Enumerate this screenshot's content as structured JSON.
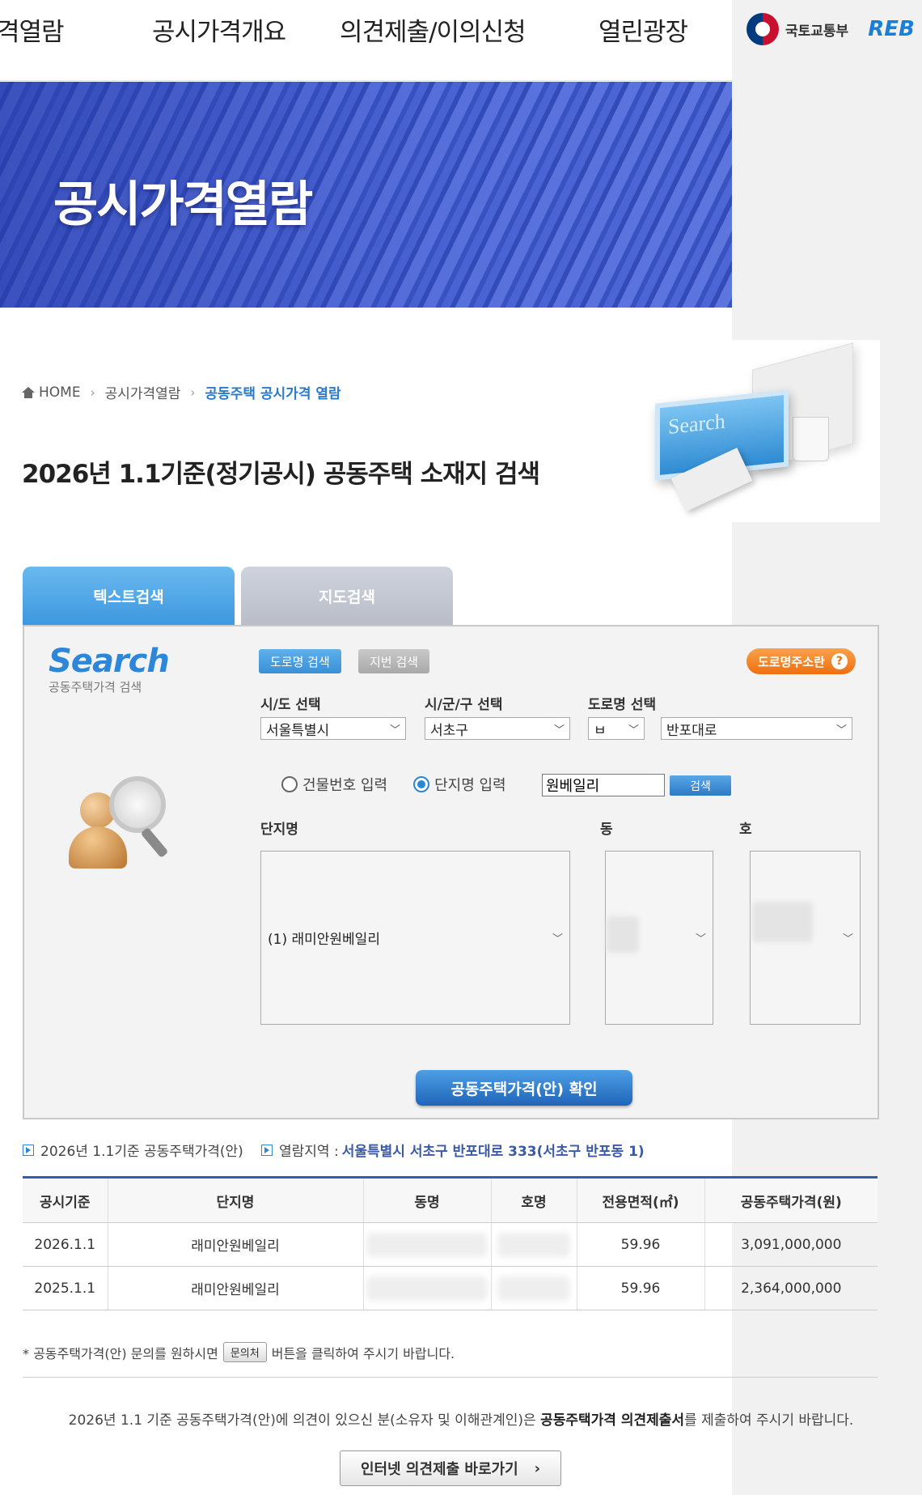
{
  "nav": {
    "items": [
      "격열람",
      "공시가격개요",
      "의견제출/이의신청",
      "열린광장"
    ],
    "molit_label": "국토교통부",
    "reb_label": "REB"
  },
  "banner": {
    "title": "공시가격열람"
  },
  "breadcrumb": {
    "home": "HOME",
    "level1": "공시가격열람",
    "current": "공동주택 공시가격 열람"
  },
  "page_title": "2026년 1.1기준(정기공시) 공동주택 소재지 검색",
  "illustration_text": "Search",
  "tabs": {
    "text_search": "텍스트검색",
    "map_search": "지도검색"
  },
  "search_panel": {
    "logo_big": "Search",
    "logo_small": "공동주택가격 검색",
    "road_search_btn": "도로명 검색",
    "jibun_search_btn": "지번 검색",
    "road_guide_btn": "도로명주소란",
    "sido_label": "시/도 선택",
    "sido_value": "서울특별시",
    "sigungu_label": "시/군/구 선택",
    "sigungu_value": "서초구",
    "road_label": "도로명 선택",
    "road_initial_value": "ㅂ",
    "road_value": "반포대로",
    "radio_building": "건물번호 입력",
    "radio_complex": "단지명 입력",
    "complex_input_value": "원베일리",
    "search_btn": "검색",
    "complex_list_label": "단지명",
    "complex_list_value": "(1) 래미안원베일리",
    "dong_label": "동",
    "ho_label": "호",
    "confirm_btn": "공동주택가격(안) 확인"
  },
  "info": {
    "basis": "2026년 1.1기준 공동주택가격(안)",
    "area_label": "열람지역 :",
    "area_value": "서울특별시 서초구 반포대로 333(서초구 반포동 1)"
  },
  "table": {
    "headers": [
      "공시기준",
      "단지명",
      "동명",
      "호명",
      "전용면적(㎡)",
      "공동주택가격(원)"
    ],
    "rows": [
      [
        "2026.1.1",
        "래미안원베일리",
        "",
        "",
        "59.96",
        "3,091,000,000"
      ],
      [
        "2025.1.1",
        "래미안원베일리",
        "",
        "",
        "59.96",
        "2,364,000,000"
      ]
    ]
  },
  "note": {
    "prefix": "* 공동주택가격(안) 문의를 원하시면",
    "button": "문의처",
    "suffix": "버튼을 클릭하여 주시기 바랍니다."
  },
  "notice": {
    "part1": "2026년 1.1 기준 공동주택가격(안)에 의견이 있으신 분(소유자 및 이해관계인)은",
    "strong": "공동주택가격 의견제출서",
    "part2": "를 제출하여 주시기 바랍니다."
  },
  "internet_btn": "인터넷 의견제출 바로가기",
  "colors": {
    "accent": "#2d86d8",
    "orange": "#ee6f10",
    "table_top": "#2d5fb0"
  }
}
